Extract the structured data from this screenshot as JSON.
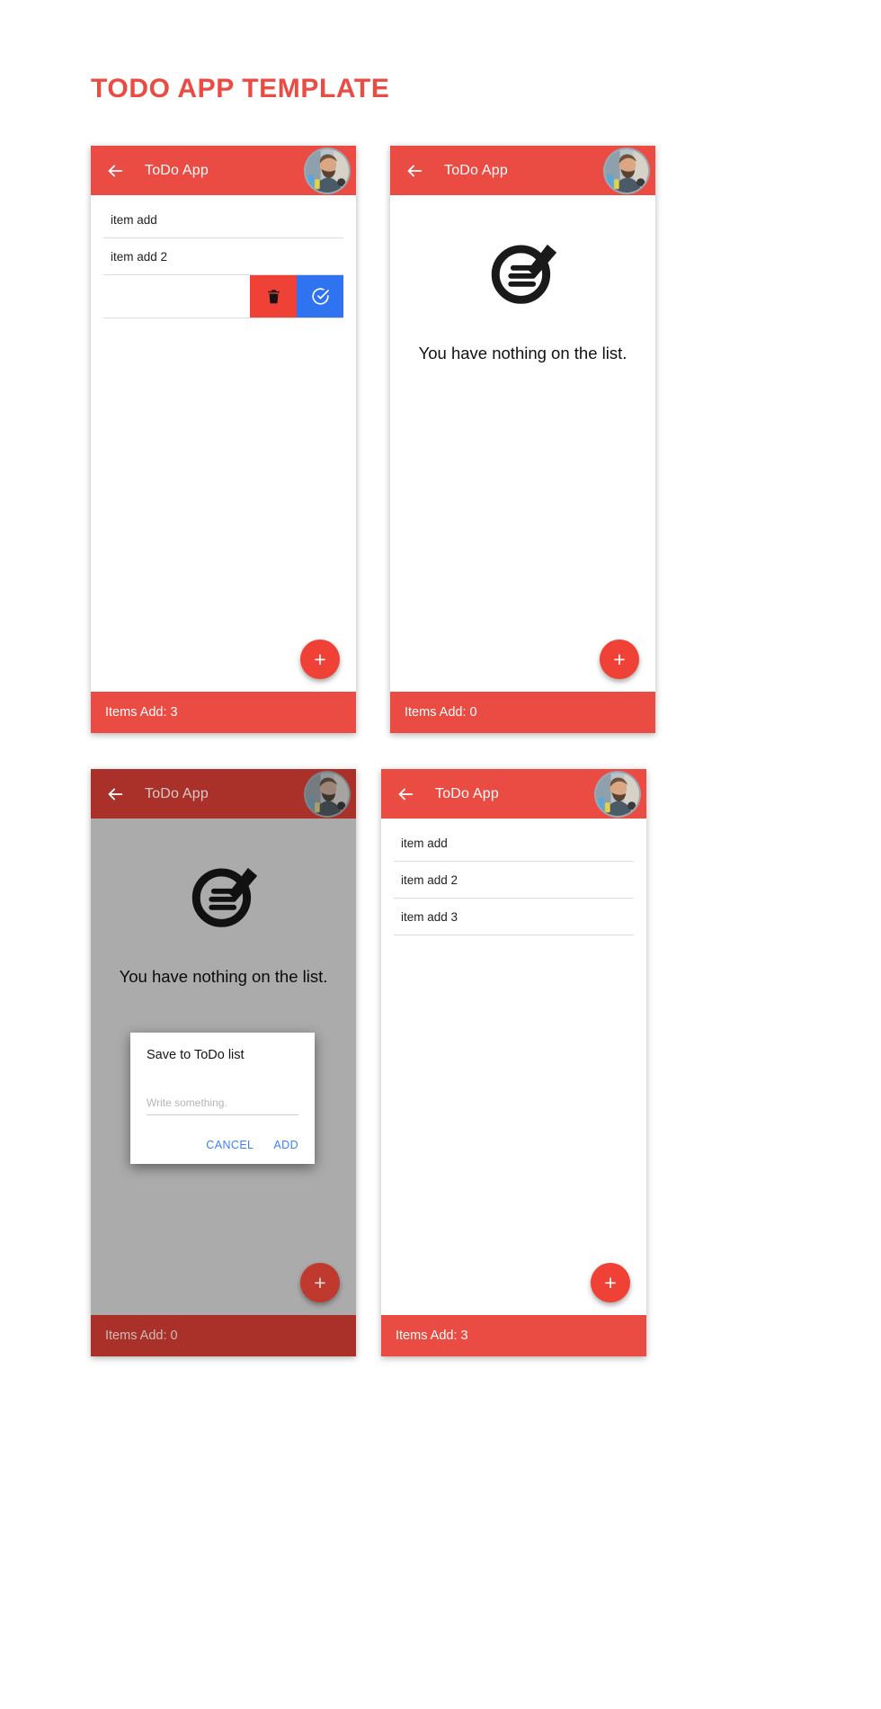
{
  "header": {
    "title": "TODO APP TEMPLATE",
    "accent_color": "#ea4b42"
  },
  "icons": {
    "back": "back-arrow-icon",
    "avatar": "user-avatar",
    "trash": "trash-icon",
    "check_circle": "check-circle-icon",
    "empty_list": "notepad-pen-icon",
    "fab_plus": "plus-icon"
  },
  "panels": [
    {
      "id": "panel-list-with-swipe",
      "appbar": {
        "title": "ToDo App"
      },
      "state": "list",
      "dimmed": false,
      "items": [
        "item add",
        "item add 2"
      ],
      "swipe_row": {
        "delete_label": "",
        "done_label": "",
        "delete_color": "#ef4136",
        "done_color": "#2f73f0"
      },
      "fab": {
        "label": "+"
      },
      "bottombar": {
        "label": "Items Add: 3"
      }
    },
    {
      "id": "panel-empty",
      "appbar": {
        "title": "ToDo App"
      },
      "state": "empty",
      "dimmed": false,
      "empty_text": "You have nothing on the list.",
      "fab": {
        "label": "+"
      },
      "bottombar": {
        "label": "Items Add: 0"
      }
    },
    {
      "id": "panel-dialog",
      "appbar": {
        "title": "ToDo App"
      },
      "state": "empty-with-dialog",
      "dimmed": true,
      "empty_text": "You have nothing on the list.",
      "dialog": {
        "title": "Save to ToDo list",
        "input_value": "",
        "input_placeholder": "Write something.",
        "cancel_label": "CANCEL",
        "add_label": "ADD",
        "action_color": "#3b82f6"
      },
      "fab": {
        "label": "+"
      },
      "bottombar": {
        "label": "Items Add: 0"
      }
    },
    {
      "id": "panel-list-three",
      "appbar": {
        "title": "ToDo App"
      },
      "state": "list",
      "dimmed": false,
      "items": [
        "item add",
        "item add 2",
        "item add 3"
      ],
      "fab": {
        "label": "+"
      },
      "bottombar": {
        "label": "Items Add: 3"
      }
    }
  ]
}
